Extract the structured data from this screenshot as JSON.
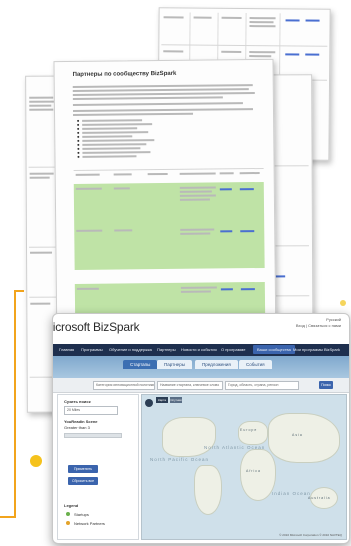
{
  "document": {
    "heading": "Партнеры по сообществу BizSpark"
  },
  "app": {
    "logo_text": "Microsoft BizSpark",
    "language": "Русский",
    "user_links": "Вход | Связаться с нами",
    "nav": [
      "Главная",
      "Программы",
      "Обучение и поддержка",
      "Партнеры",
      "Новости и события",
      "О программе",
      "Ваши сообщества",
      "Мои программы BizSpark"
    ],
    "tabs": [
      "Стартапы",
      "Партнеры",
      "Предложения",
      "События"
    ],
    "filter": {
      "select_placeholder": "Категория инновационной политики",
      "input_placeholder": "Название стартапа, ключевое слово",
      "location_placeholder": "Город, область, страна, регион",
      "search_button": "Поиск"
    },
    "sidebar": {
      "sort_label": "Сузить поиск",
      "sort_value": "20 Miles",
      "heading": "YouReadin Scene",
      "subheading": "Greater than 3",
      "apply_button": "Применить",
      "reset_button": "Сбросить все",
      "legend_title": "Legend",
      "legend_items": [
        {
          "label": "Startups",
          "color": "#6ab04c"
        },
        {
          "label": "Network Partners",
          "color": "#e3a32b"
        }
      ]
    },
    "map": {
      "toggle_map": "Карта",
      "toggle_sat": "Спутник",
      "oceans": [
        "North Pacific Ocean",
        "North Atlantic Ocean",
        "Indian Ocean"
      ],
      "continents": [
        "Europe",
        "Asia",
        "Africa",
        "Australia"
      ],
      "attribution": "© 2010 Microsoft Corporation   © 2010 NAVTEQ"
    }
  }
}
